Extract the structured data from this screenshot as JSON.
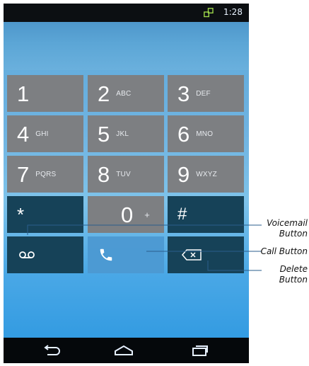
{
  "status_bar": {
    "time": "1:28",
    "icons": [
      "network-icon"
    ]
  },
  "keypad": {
    "keys": [
      {
        "digit": "1",
        "letters": ""
      },
      {
        "digit": "2",
        "letters": "ABC"
      },
      {
        "digit": "3",
        "letters": "DEF"
      },
      {
        "digit": "4",
        "letters": "GHI"
      },
      {
        "digit": "5",
        "letters": "JKL"
      },
      {
        "digit": "6",
        "letters": "MNO"
      },
      {
        "digit": "7",
        "letters": "PQRS"
      },
      {
        "digit": "8",
        "letters": "TUV"
      },
      {
        "digit": "9",
        "letters": "WXYZ"
      },
      {
        "digit": "*",
        "letters": ""
      },
      {
        "digit": "0",
        "letters": "+"
      },
      {
        "digit": "#",
        "letters": ""
      }
    ]
  },
  "actions": {
    "voicemail_icon": "voicemail-icon",
    "call_icon": "phone-icon",
    "delete_icon": "backspace-icon"
  },
  "nav": {
    "icons": [
      "back-icon",
      "home-icon",
      "recent-apps-icon"
    ]
  },
  "callouts": {
    "voicemail": [
      "Voicemail",
      "Button"
    ],
    "call": [
      "Call Button"
    ],
    "delete": [
      "Delete",
      "Button"
    ]
  },
  "colors": {
    "key_gray": "#7d7f82",
    "key_dark": "#164258",
    "status_icon": "#9cd64a",
    "background_blue": "#2a96e0"
  }
}
